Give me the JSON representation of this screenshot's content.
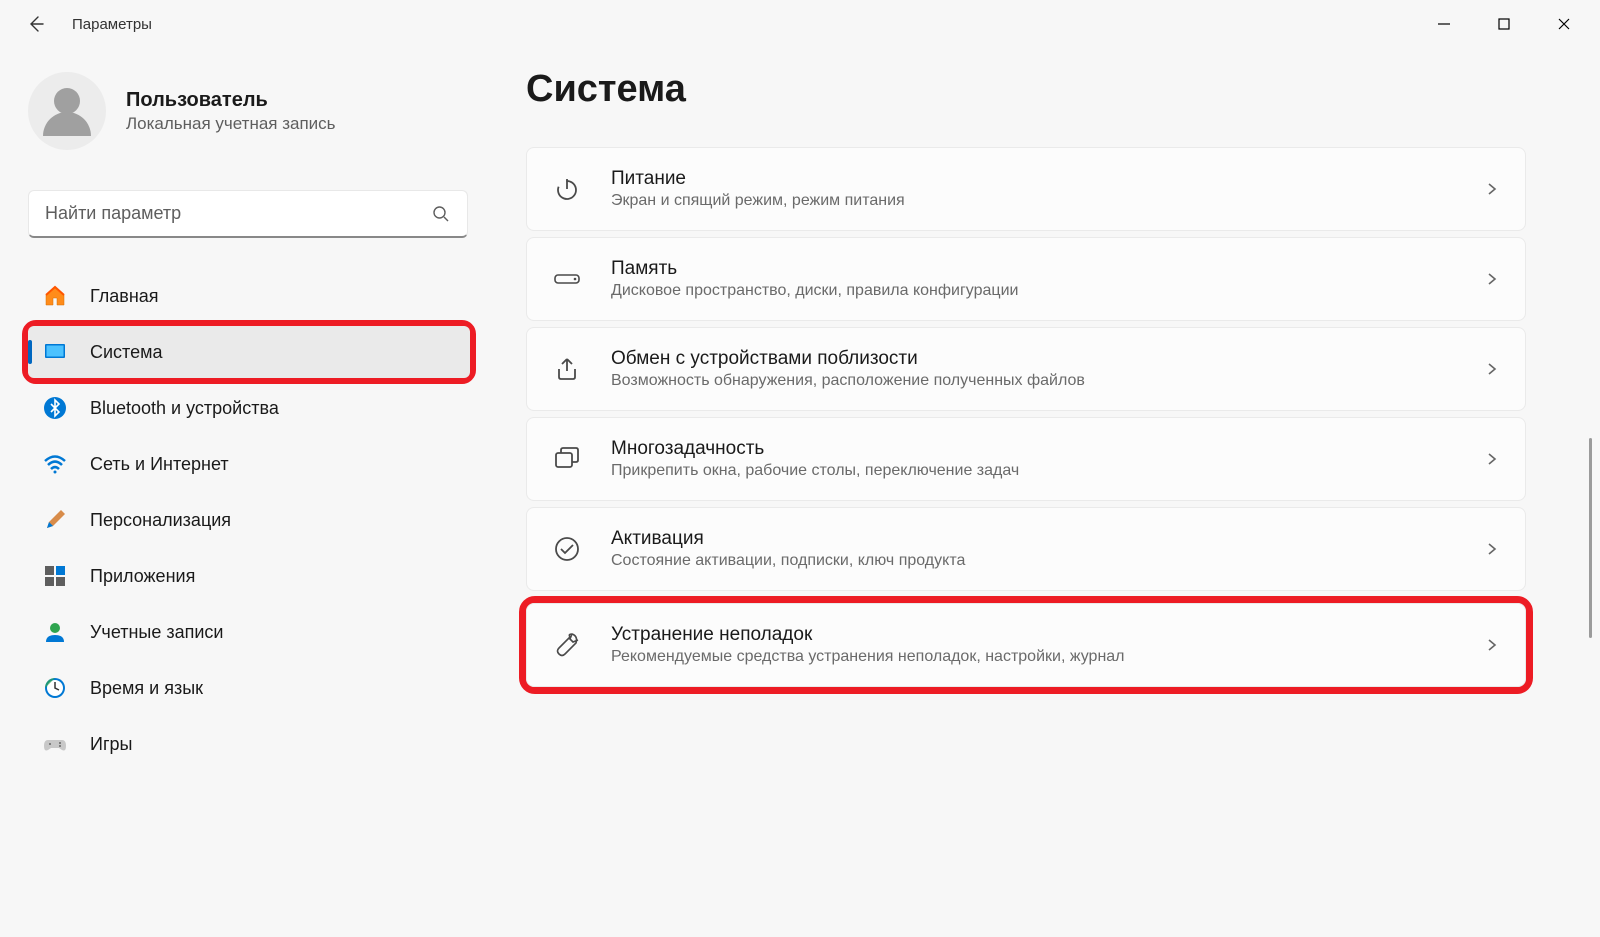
{
  "app": {
    "title": "Параметры"
  },
  "user": {
    "name": "Пользователь",
    "subtitle": "Локальная учетная запись"
  },
  "search": {
    "placeholder": "Найти параметр"
  },
  "nav": {
    "items": [
      {
        "id": "home",
        "label": "Главная"
      },
      {
        "id": "system",
        "label": "Система"
      },
      {
        "id": "bluetooth",
        "label": "Bluetooth и устройства"
      },
      {
        "id": "network",
        "label": "Сеть и Интернет"
      },
      {
        "id": "personalization",
        "label": "Персонализация"
      },
      {
        "id": "apps",
        "label": "Приложения"
      },
      {
        "id": "accounts",
        "label": "Учетные записи"
      },
      {
        "id": "time",
        "label": "Время и язык"
      },
      {
        "id": "gaming",
        "label": "Игры"
      }
    ]
  },
  "main": {
    "title": "Система",
    "cards": [
      {
        "id": "power",
        "title": "Питание",
        "subtitle": "Экран и спящий режим, режим питания"
      },
      {
        "id": "storage",
        "title": "Память",
        "subtitle": "Дисковое пространство, диски, правила конфигурации"
      },
      {
        "id": "nearby",
        "title": "Обмен с устройствами поблизости",
        "subtitle": "Возможность обнаружения, расположение полученных файлов"
      },
      {
        "id": "multitask",
        "title": "Многозадачность",
        "subtitle": "Прикрепить окна, рабочие столы, переключение задач"
      },
      {
        "id": "activation",
        "title": "Активация",
        "subtitle": "Состояние активации, подписки, ключ продукта"
      },
      {
        "id": "troubleshoot",
        "title": "Устранение неполадок",
        "subtitle": "Рекомендуемые средства устранения неполадок, настройки, журнал"
      }
    ]
  }
}
